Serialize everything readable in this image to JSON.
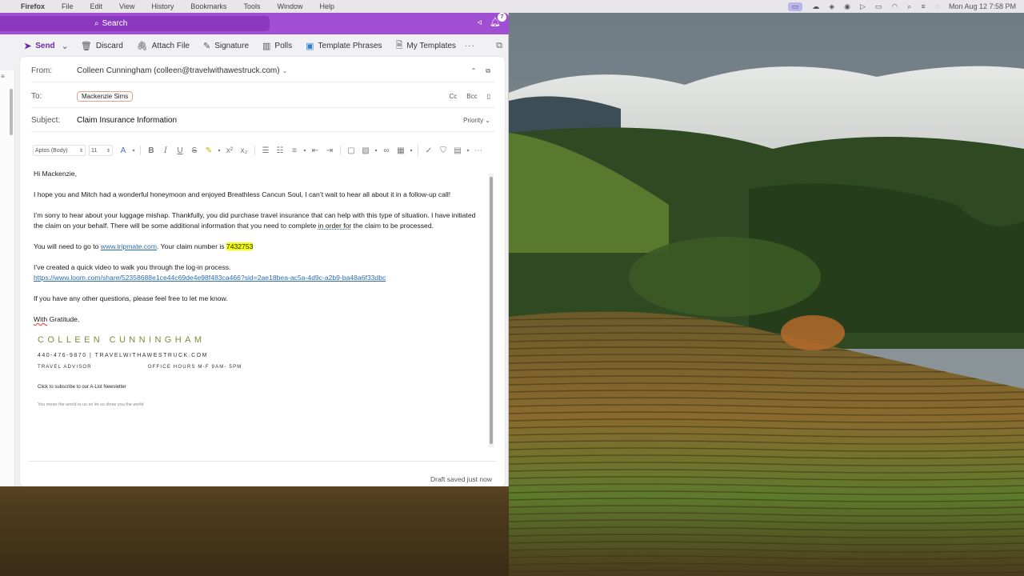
{
  "menubar": {
    "app": "Firefox",
    "items": [
      "File",
      "Edit",
      "View",
      "History",
      "Bookmarks",
      "Tools",
      "Window",
      "Help"
    ],
    "clock": "Mon Aug 12  7:58 PM"
  },
  "titlebar": {
    "search_label": "Search",
    "notification_count": "7"
  },
  "toolbar": {
    "send": "Send",
    "discard": "Discard",
    "attach": "Attach File",
    "signature": "Signature",
    "polls": "Polls",
    "template_phrases": "Template Phrases",
    "my_templates": "My Templates",
    "more": "···"
  },
  "compose": {
    "from_label": "From:",
    "from_value": "Colleen Cunningham (colleen@travelwithawestruck.com)",
    "to_label": "To:",
    "to_recipient": "Mackenzie Sims",
    "cc": "Cc",
    "bcc": "Bcc",
    "subject_label": "Subject:",
    "subject_value": "Claim Insurance Information",
    "priority": "Priority"
  },
  "format": {
    "font": "Aptos (Body)",
    "size": "11"
  },
  "body": {
    "greeting": "Hi Mackenzie,",
    "p1": "I hope you and Mitch had a wonderful honeymoon and enjoyed Breathless Cancun Soul, I can’t wait to hear all about it in a follow-up call!",
    "p2_a": "I’m sorry to hear about your luggage mishap. Thankfully, you did purchase travel insurance that can help with this type of situation. I have initiated the claim on your behalf. There will be some additional information that you need to complete ",
    "p2_b": "in order for",
    "p2_c": " the claim to be processed.",
    "p3_a": "You will need to go to ",
    "p3_link": "www.tripmate.com",
    "p3_b": ". Your claim number is ",
    "p3_claim": "7432753",
    "p4": "I’ve created a quick video to walk you through the log-in process.",
    "p4_link": "https://www.loom.com/share/52358688e1ce44c69de4e98f483ca466?sid=2ae18bea-ac5a-4d9c-a2b9-ba48a6f33dbc",
    "p5": "If you have any other questions, please feel free to let me know.",
    "closing_a": "With",
    "closing_b": " Gratitude,"
  },
  "signature": {
    "name": "COLLEEN CUNNINGHAM",
    "contact": "440-476-9870  |  TRAVELWITHAWESTRUCK.COM",
    "role": "TRAVEL ADVISOR",
    "hours": "OFFICE HOURS M-F 9AM- 5PM",
    "newsletter": "Click to subscribe to our A-List Newsletter",
    "tagline": "You mean the world to us so let us show you the world"
  },
  "status": {
    "draft": "Draft saved just now"
  },
  "colors": {
    "accent": "#a04ed2",
    "accent_dark": "#8a39bf",
    "send": "#6a2aa8",
    "highlight": "#f6ff00",
    "link": "#2b6cae",
    "signature_green": "#7a8f3b"
  }
}
